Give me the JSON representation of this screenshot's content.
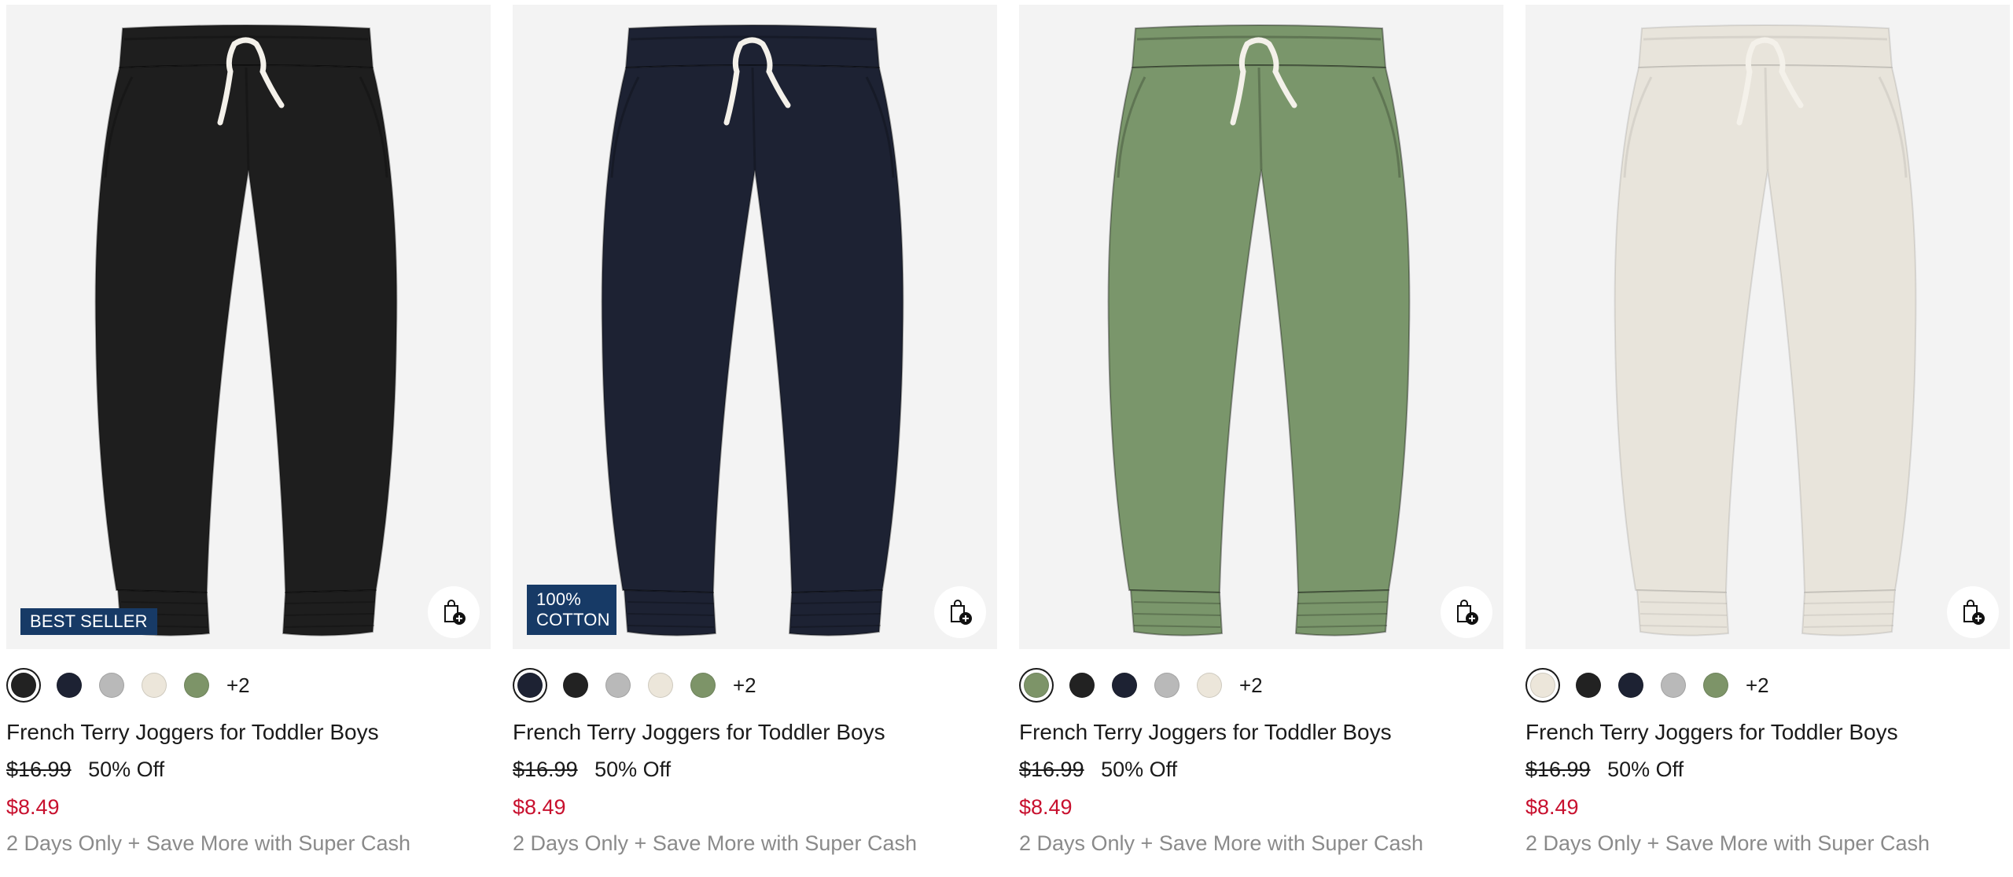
{
  "products": [
    {
      "name": "French Terry Joggers for Toddler Boys",
      "badge": "BEST SELLER",
      "garment_color": "#1e1e1e",
      "swatches": [
        "#222222",
        "#1d2233",
        "#b9b9b9",
        "#ece6da",
        "#7d9468"
      ],
      "more_colors": "+2",
      "original_price": "$16.99",
      "discount": "50% Off",
      "sale_price": "$8.49",
      "promo": "2 Days Only + Save More with Super Cash"
    },
    {
      "name": "French Terry Joggers for Toddler Boys",
      "badge": "100%\nCOTTON",
      "garment_color": "#1d2233",
      "swatches": [
        "#1d2233",
        "#222222",
        "#b9b9b9",
        "#ece6da",
        "#7d9468"
      ],
      "more_colors": "+2",
      "original_price": "$16.99",
      "discount": "50% Off",
      "sale_price": "$8.49",
      "promo": "2 Days Only + Save More with Super Cash"
    },
    {
      "name": "French Terry Joggers for Toddler Boys",
      "badge": "",
      "garment_color": "#7a966b",
      "swatches": [
        "#7d9468",
        "#222222",
        "#1d2233",
        "#b9b9b9",
        "#ece6da"
      ],
      "more_colors": "+2",
      "original_price": "$16.99",
      "discount": "50% Off",
      "sale_price": "$8.49",
      "promo": "2 Days Only + Save More with Super Cash"
    },
    {
      "name": "French Terry Joggers for Toddler Boys",
      "badge": "",
      "garment_color": "#e8e4db",
      "swatches": [
        "#ece6da",
        "#222222",
        "#1d2233",
        "#b9b9b9",
        "#7d9468"
      ],
      "more_colors": "+2",
      "original_price": "$16.99",
      "discount": "50% Off",
      "sale_price": "$8.49",
      "promo": "2 Days Only + Save More with Super Cash"
    }
  ],
  "colors": {
    "sale": "#c8102e",
    "badge_bg": "#173a66",
    "promo_text": "#8a8a8a"
  },
  "icons": {
    "quick_add": "shopping-bag-plus-icon"
  }
}
